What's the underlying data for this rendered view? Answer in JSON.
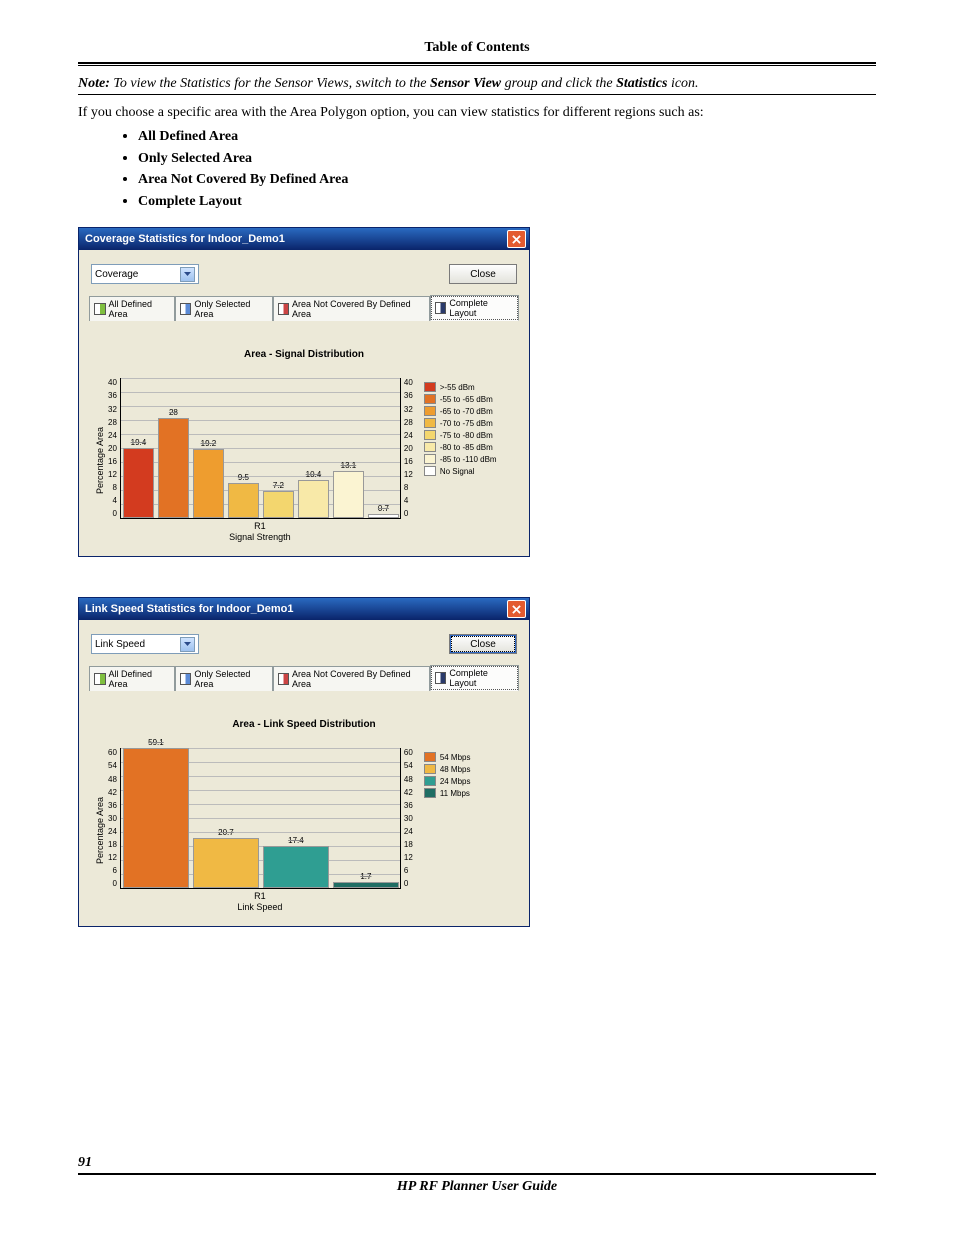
{
  "header": {
    "toc": "Table of Contents"
  },
  "note": {
    "label": "Note:",
    "p1": "To view the Statistics for the Sensor Views, switch to the ",
    "em1": "Sensor View",
    "p2": " group and click the ",
    "em2": "Statistics",
    "p3": " icon."
  },
  "intro": "If you choose a specific area with the Area Polygon option, you can view statistics for different regions such as:",
  "bullets": [
    "All Defined Area",
    "Only Selected Area",
    "Area Not Covered By Defined Area",
    "Complete Layout"
  ],
  "tabs": {
    "t1": "All Defined Area",
    "t2": "Only Selected Area",
    "t3": "Area Not Covered By Defined Area",
    "t4": "Complete Layout"
  },
  "close_label": "Close",
  "win1": {
    "title": "Coverage Statistics for Indoor_Demo1",
    "select": "Coverage",
    "chart_title": "Area - Signal Distribution",
    "ylabel": "Percentage Area",
    "xaxis": "R1",
    "xlabel": "Signal Strength"
  },
  "win2": {
    "title": "Link Speed Statistics for Indoor_Demo1",
    "select": "Link Speed",
    "chart_title": "Area - Link Speed Distribution",
    "ylabel": "Percentage Area",
    "xaxis": "R1",
    "xlabel": "Link Speed"
  },
  "chart_data": [
    {
      "type": "bar",
      "title": "Area - Signal Distribution",
      "xlabel": "Signal Strength",
      "ylabel": "Percentage Area",
      "ylim": [
        0,
        40
      ],
      "yticks": [
        0,
        4,
        8,
        12,
        16,
        20,
        24,
        28,
        32,
        36,
        40
      ],
      "categories": [
        ">-55 dBm",
        "-55 to -65 dBm",
        "-65 to -70 dBm",
        "-70 to -75 dBm",
        "-75 to -80 dBm",
        "-80 to -85 dBm",
        "-85 to -110 dBm",
        "No Signal"
      ],
      "colors": [
        "#d33b1f",
        "#e27224",
        "#ee9d2f",
        "#f0b944",
        "#f3d66e",
        "#f8e9a8",
        "#fbf4d2",
        "#ffffff"
      ],
      "values": [
        19.4,
        28,
        19.2,
        9.5,
        7.2,
        10.4,
        13.1,
        0.7
      ],
      "labels": [
        "19.4",
        "28",
        "19.2",
        "9.5",
        "7.2",
        "10.4",
        "13.1",
        "0.7"
      ]
    },
    {
      "type": "bar",
      "title": "Area - Link Speed Distribution",
      "xlabel": "Link Speed",
      "ylabel": "Percentage Area",
      "ylim": [
        0,
        60
      ],
      "yticks": [
        0,
        6,
        12,
        18,
        24,
        30,
        36,
        42,
        48,
        54,
        60
      ],
      "categories": [
        "54 Mbps",
        "48 Mbps",
        "24 Mbps",
        "11 Mbps"
      ],
      "colors": [
        "#e27224",
        "#f0b944",
        "#2f9e92",
        "#1f6d63"
      ],
      "values": [
        59.1,
        20.7,
        17.4,
        1.7
      ],
      "labels": [
        "59.1",
        "20.7",
        "17.4",
        "1.7"
      ]
    }
  ],
  "footer": {
    "page": "91",
    "title": "HP RF Planner User Guide"
  }
}
